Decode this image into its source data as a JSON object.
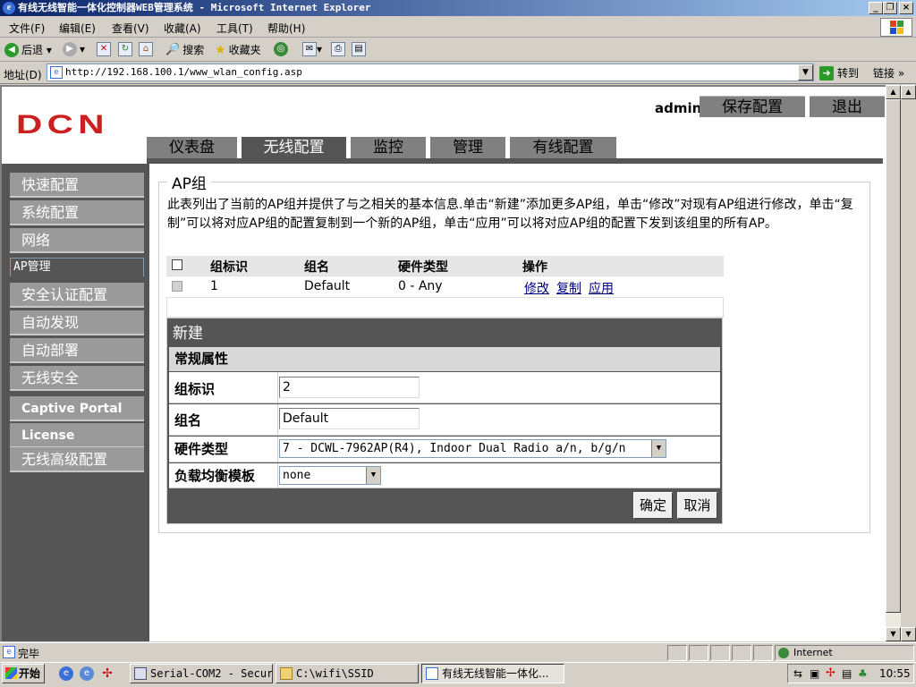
{
  "window": {
    "title": "有线无线智能一体化控制器WEB管理系统 - Microsoft Internet Explorer"
  },
  "menu": [
    "文件(F)",
    "编辑(E)",
    "查看(V)",
    "收藏(A)",
    "工具(T)",
    "帮助(H)"
  ],
  "toolbar": {
    "back": "后退",
    "search": "搜索",
    "favorites": "收藏夹"
  },
  "address": {
    "label": "地址(D)",
    "url": "http://192.168.100.1/www_wlan_config.asp",
    "go": "转到",
    "links": "链接"
  },
  "header": {
    "logo": "DCN",
    "user": "admin",
    "save_config": "保存配置",
    "logout": "退出"
  },
  "nav_tabs": [
    "仪表盘",
    "无线配置",
    "监控",
    "管理",
    "有线配置"
  ],
  "sidebar": [
    "快速配置",
    "系统配置",
    "网络",
    "AP管理",
    "安全认证配置",
    "自动发现",
    "自动部署",
    "无线安全",
    "Captive Portal",
    "License",
    "无线高级配置"
  ],
  "content": {
    "legend": "AP组",
    "description": "此表列出了当前的AP组并提供了与之相关的基本信息.单击“新建”添加更多AP组，单击“修改”对现有AP组进行修改，单击“复制”可以将对应AP组的配置复制到一个新的AP组，单击“应用”可以将对应AP组的配置下发到该组里的所有AP。",
    "table": {
      "headers": [
        "组标识",
        "组名",
        "硬件类型",
        "操作"
      ],
      "rows": [
        {
          "id": "1",
          "name": "Default",
          "hardware": "0 - Any",
          "actions": [
            "修改",
            "复制",
            "应用"
          ]
        }
      ]
    }
  },
  "form": {
    "title": "新建",
    "section": "常规属性",
    "group_id_label": "组标识",
    "group_id_value": "2",
    "group_name_label": "组名",
    "group_name_value": "Default",
    "hardware_label": "硬件类型",
    "hardware_value": "7 - DCWL-7962AP(R4), Indoor Dual Radio a/n, b/g/n",
    "lb_label": "负载均衡模板",
    "lb_value": "none",
    "ok": "确定",
    "cancel": "取消"
  },
  "statusbar": {
    "text": "完毕",
    "zone": "Internet"
  },
  "taskbar": {
    "start": "开始",
    "tasks": [
      "Serial-COM2 - Secur...",
      "C:\\wifi\\SSID",
      "有线无线智能一体化..."
    ],
    "clock": "10:55"
  }
}
